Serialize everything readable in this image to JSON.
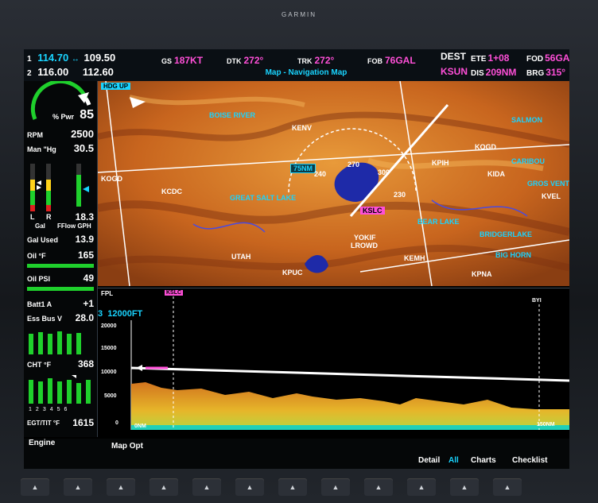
{
  "bezel": {
    "brand": "GARMIN"
  },
  "nav": {
    "nav1": {
      "id": "1",
      "active": "114.70",
      "arrow": "↔",
      "standby": "109.50"
    },
    "nav2": {
      "id": "2",
      "active": "116.00",
      "standby": "112.60"
    }
  },
  "data_fields": {
    "gs": {
      "label": "GS",
      "value": "187KT"
    },
    "dtk": {
      "label": "DTK",
      "value": "272°"
    },
    "trk": {
      "label": "TRK",
      "value": "272°"
    },
    "fob": {
      "label": "FOB",
      "value": "76GAL"
    }
  },
  "map_title": "Map - Navigation Map",
  "dest": {
    "dest_label": "DEST",
    "dest_value": "KSUN",
    "ete_label": "ETE",
    "ete_value": "1+08",
    "fod_label": "FOD",
    "fod_value": "56GA",
    "dis_label": "DIS",
    "dis_value": "209NM",
    "brg_label": "BRG",
    "brg_value": "315°"
  },
  "engine": {
    "pwr_label": "% Pwr",
    "pwr_value": "85",
    "rpm_label": "RPM",
    "rpm_value": "2500",
    "man_label": "Man \"Hg",
    "man_value": "30.5",
    "fuel_l": "L",
    "fuel_r": "R",
    "fuel_label": "Gal",
    "fflow_label": "FFlow GPH",
    "fflow_value": "18.3",
    "gal_used_label": "Gal Used",
    "gal_used_value": "13.9",
    "oil_t_label": "Oil °F",
    "oil_t_value": "165",
    "oil_p_label": "Oil PSI",
    "oil_p_value": "49",
    "batt_label": "Batt1 A",
    "batt_value": "+1",
    "ess_label": "Ess Bus V",
    "ess_value": "28.0",
    "cht_label": "CHT °F",
    "cht_value": "368",
    "egt_label": "EGT/TIT °F",
    "egt_value": "1615",
    "cyl_numbers": [
      "1",
      "2",
      "3",
      "4",
      "5",
      "6"
    ]
  },
  "map": {
    "orient": "HDG UP",
    "range": "75NM",
    "arc_labels": [
      "240",
      "270",
      "300"
    ],
    "airports": [
      "KENV",
      "KPIH",
      "KIDA",
      "KOGD",
      "KCDC",
      "KEMH",
      "KPUC",
      "KPNA",
      "KVEL"
    ],
    "labels": [
      "UTAH",
      "KOGD",
      "YOKIF",
      "LROWD"
    ],
    "wpt_box": "KSLC",
    "small_alts": [
      "230"
    ],
    "cyan_labels": [
      "BOISE RIVER",
      "SALMON",
      "GREAT SALT LAKE",
      "BEAR LAKE",
      "BRIDGERLAKE",
      "CARIBOU",
      "BIG HORN",
      "GROS VENTRE"
    ]
  },
  "profile": {
    "label": "FPL",
    "alt_label": "12000FT",
    "scale": [
      "20000",
      "15000",
      "10000",
      "5000",
      "0"
    ],
    "left_range": "0NM",
    "right_range": "150NM",
    "waypoints": [
      "KSLC",
      "BYI"
    ],
    "path_marker": "3"
  },
  "softkeys": {
    "engine": "Engine",
    "map_opt": "Map Opt",
    "detail": "Detail",
    "all": "All",
    "charts": "Charts",
    "checklist": "Checklist"
  }
}
